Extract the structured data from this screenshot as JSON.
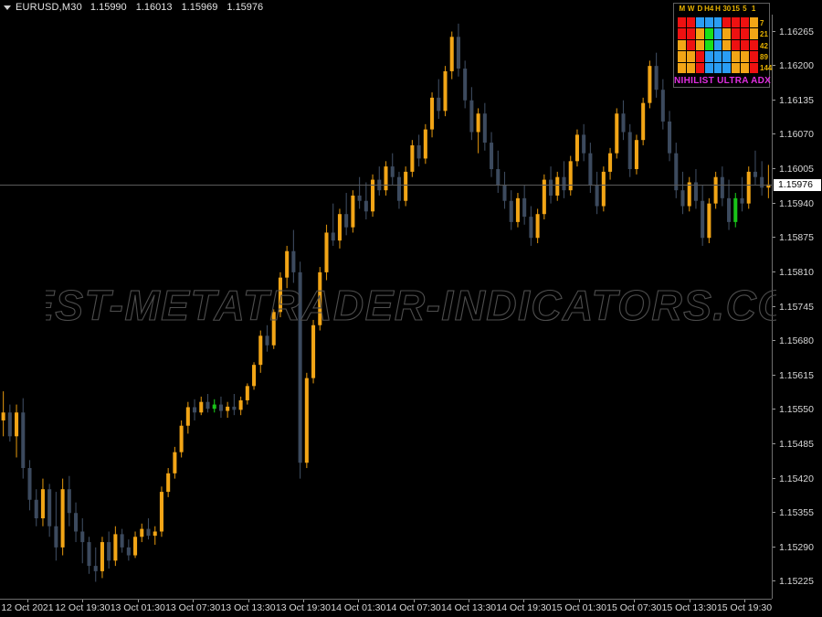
{
  "window": {
    "symbol_line": "EURUSD,M30",
    "dropdown_icon": "triangle-down-icon"
  },
  "ohlc": {
    "open": "1.15990",
    "high": "1.16013",
    "low": "1.15969",
    "close": "1.15976"
  },
  "watermark": {
    "text": "BEST-METATRADER-INDICATORS.COM"
  },
  "price_axis": {
    "current_price": "1.15976",
    "labels": [
      "1.16265",
      "1.16200",
      "1.16135",
      "1.16070",
      "1.16005",
      "1.15940",
      "1.15875",
      "1.15810",
      "1.15745",
      "1.15680",
      "1.15615",
      "1.15550",
      "1.15485",
      "1.15420",
      "1.15355",
      "1.15290",
      "1.15225"
    ]
  },
  "time_axis": {
    "labels": [
      "12 Oct 2021",
      "12 Oct 19:30",
      "13 Oct 01:30",
      "13 Oct 07:30",
      "13 Oct 13:30",
      "13 Oct 19:30",
      "14 Oct 01:30",
      "14 Oct 07:30",
      "14 Oct 13:30",
      "14 Oct 19:30",
      "15 Oct 01:30",
      "15 Oct 07:30",
      "15 Oct 13:30",
      "15 Oct 19:30"
    ]
  },
  "indicator": {
    "name": "NIHILIST ULTRA ADX",
    "columns": [
      "M",
      "W",
      "D",
      "H4",
      "H",
      "30",
      "15",
      "5",
      "1"
    ],
    "rows": [
      "7",
      "21",
      "42",
      "89",
      "144"
    ],
    "colors": {
      "red": "#ee1111",
      "blue": "#2a9df4",
      "orange": "#f2a516",
      "green": "#19e019"
    },
    "grid": [
      [
        "red",
        "red",
        "blue",
        "blue",
        "blue",
        "red",
        "red",
        "red",
        "orange"
      ],
      [
        "red",
        "red",
        "orange",
        "green",
        "blue",
        "orange",
        "red",
        "red",
        "orange"
      ],
      [
        "orange",
        "red",
        "orange",
        "green",
        "blue",
        "orange",
        "red",
        "red",
        "red"
      ],
      [
        "orange",
        "orange",
        "red",
        "blue",
        "blue",
        "blue",
        "orange",
        "orange",
        "red"
      ],
      [
        "orange",
        "orange",
        "red",
        "blue",
        "blue",
        "blue",
        "orange",
        "orange",
        "red"
      ]
    ]
  },
  "chart_data": {
    "type": "candlestick",
    "title": "EURUSD,M30",
    "xlabel": "",
    "ylabel": "",
    "ylim": [
      1.15193,
      1.16297
    ],
    "colors": {
      "bull": "#f2a516",
      "bear": "#3c4a5e",
      "doji": "#19c419",
      "wick_bull": "#d18b0c",
      "wick_bear": "#3c4a5e"
    },
    "grid": false,
    "price_line": 1.15976,
    "candles": [
      {
        "o": 1.1553,
        "h": 1.15585,
        "l": 1.155,
        "c": 1.15545,
        "d": "up"
      },
      {
        "o": 1.15545,
        "h": 1.1556,
        "l": 1.1549,
        "c": 1.155,
        "d": "down"
      },
      {
        "o": 1.155,
        "h": 1.1556,
        "l": 1.1546,
        "c": 1.15545,
        "d": "up"
      },
      {
        "o": 1.15545,
        "h": 1.15572,
        "l": 1.1542,
        "c": 1.1544,
        "d": "down"
      },
      {
        "o": 1.1544,
        "h": 1.15455,
        "l": 1.1536,
        "c": 1.1538,
        "d": "down"
      },
      {
        "o": 1.1538,
        "h": 1.154,
        "l": 1.1533,
        "c": 1.15345,
        "d": "down"
      },
      {
        "o": 1.15345,
        "h": 1.1542,
        "l": 1.1533,
        "c": 1.154,
        "d": "up"
      },
      {
        "o": 1.154,
        "h": 1.1541,
        "l": 1.1531,
        "c": 1.1533,
        "d": "down"
      },
      {
        "o": 1.1533,
        "h": 1.15395,
        "l": 1.15265,
        "c": 1.1529,
        "d": "down"
      },
      {
        "o": 1.1529,
        "h": 1.1542,
        "l": 1.15275,
        "c": 1.154,
        "d": "up"
      },
      {
        "o": 1.154,
        "h": 1.15425,
        "l": 1.1533,
        "c": 1.15355,
        "d": "down"
      },
      {
        "o": 1.15355,
        "h": 1.15375,
        "l": 1.153,
        "c": 1.1532,
        "d": "down"
      },
      {
        "o": 1.1532,
        "h": 1.15345,
        "l": 1.1526,
        "c": 1.153,
        "d": "down"
      },
      {
        "o": 1.153,
        "h": 1.1531,
        "l": 1.1524,
        "c": 1.15255,
        "d": "down"
      },
      {
        "o": 1.15255,
        "h": 1.1529,
        "l": 1.15225,
        "c": 1.15245,
        "d": "down"
      },
      {
        "o": 1.15245,
        "h": 1.1531,
        "l": 1.15232,
        "c": 1.153,
        "d": "up"
      },
      {
        "o": 1.153,
        "h": 1.1532,
        "l": 1.1525,
        "c": 1.15265,
        "d": "down"
      },
      {
        "o": 1.15265,
        "h": 1.1533,
        "l": 1.15255,
        "c": 1.15315,
        "d": "up"
      },
      {
        "o": 1.15315,
        "h": 1.15325,
        "l": 1.1528,
        "c": 1.1529,
        "d": "down"
      },
      {
        "o": 1.1529,
        "h": 1.15305,
        "l": 1.15265,
        "c": 1.15275,
        "d": "down"
      },
      {
        "o": 1.15275,
        "h": 1.1532,
        "l": 1.1527,
        "c": 1.1531,
        "d": "up"
      },
      {
        "o": 1.1531,
        "h": 1.15335,
        "l": 1.153,
        "c": 1.15325,
        "d": "up"
      },
      {
        "o": 1.15325,
        "h": 1.15345,
        "l": 1.15305,
        "c": 1.15312,
        "d": "down"
      },
      {
        "o": 1.15312,
        "h": 1.1533,
        "l": 1.15295,
        "c": 1.1532,
        "d": "up"
      },
      {
        "o": 1.1532,
        "h": 1.15405,
        "l": 1.1531,
        "c": 1.15395,
        "d": "up"
      },
      {
        "o": 1.15395,
        "h": 1.1544,
        "l": 1.15385,
        "c": 1.1543,
        "d": "up"
      },
      {
        "o": 1.1543,
        "h": 1.1548,
        "l": 1.1542,
        "c": 1.1547,
        "d": "up"
      },
      {
        "o": 1.1547,
        "h": 1.1553,
        "l": 1.1546,
        "c": 1.1552,
        "d": "up"
      },
      {
        "o": 1.1552,
        "h": 1.15565,
        "l": 1.15505,
        "c": 1.15555,
        "d": "up"
      },
      {
        "o": 1.15555,
        "h": 1.1557,
        "l": 1.1553,
        "c": 1.15545,
        "d": "down"
      },
      {
        "o": 1.15545,
        "h": 1.15575,
        "l": 1.1554,
        "c": 1.15565,
        "d": "up"
      },
      {
        "o": 1.15565,
        "h": 1.1558,
        "l": 1.15545,
        "c": 1.15552,
        "d": "down"
      },
      {
        "o": 1.15552,
        "h": 1.1557,
        "l": 1.15545,
        "c": 1.1556,
        "d": "doji"
      },
      {
        "o": 1.1556,
        "h": 1.15575,
        "l": 1.15535,
        "c": 1.15548,
        "d": "down"
      },
      {
        "o": 1.15548,
        "h": 1.15565,
        "l": 1.15535,
        "c": 1.15556,
        "d": "up"
      },
      {
        "o": 1.15556,
        "h": 1.1558,
        "l": 1.1554,
        "c": 1.1555,
        "d": "down"
      },
      {
        "o": 1.1555,
        "h": 1.15575,
        "l": 1.1554,
        "c": 1.15568,
        "d": "up"
      },
      {
        "o": 1.15568,
        "h": 1.156,
        "l": 1.1556,
        "c": 1.15595,
        "d": "up"
      },
      {
        "o": 1.15595,
        "h": 1.1564,
        "l": 1.15588,
        "c": 1.15635,
        "d": "up"
      },
      {
        "o": 1.15635,
        "h": 1.157,
        "l": 1.1562,
        "c": 1.1569,
        "d": "up"
      },
      {
        "o": 1.1569,
        "h": 1.1571,
        "l": 1.1566,
        "c": 1.15672,
        "d": "down"
      },
      {
        "o": 1.15672,
        "h": 1.1574,
        "l": 1.15665,
        "c": 1.15735,
        "d": "up"
      },
      {
        "o": 1.15735,
        "h": 1.1581,
        "l": 1.15725,
        "c": 1.158,
        "d": "up"
      },
      {
        "o": 1.158,
        "h": 1.1586,
        "l": 1.1578,
        "c": 1.1585,
        "d": "up"
      },
      {
        "o": 1.1585,
        "h": 1.1589,
        "l": 1.1579,
        "c": 1.1581,
        "d": "down"
      },
      {
        "o": 1.1581,
        "h": 1.1583,
        "l": 1.1542,
        "c": 1.1545,
        "d": "down"
      },
      {
        "o": 1.1545,
        "h": 1.1562,
        "l": 1.1544,
        "c": 1.1561,
        "d": "up"
      },
      {
        "o": 1.1561,
        "h": 1.1572,
        "l": 1.156,
        "c": 1.1571,
        "d": "up"
      },
      {
        "o": 1.1571,
        "h": 1.1582,
        "l": 1.157,
        "c": 1.1581,
        "d": "up"
      },
      {
        "o": 1.1581,
        "h": 1.159,
        "l": 1.15795,
        "c": 1.15885,
        "d": "up"
      },
      {
        "o": 1.15885,
        "h": 1.1594,
        "l": 1.1586,
        "c": 1.1587,
        "d": "down"
      },
      {
        "o": 1.1587,
        "h": 1.1593,
        "l": 1.15855,
        "c": 1.1592,
        "d": "up"
      },
      {
        "o": 1.1592,
        "h": 1.1596,
        "l": 1.1588,
        "c": 1.15895,
        "d": "down"
      },
      {
        "o": 1.15895,
        "h": 1.15965,
        "l": 1.15885,
        "c": 1.15955,
        "d": "up"
      },
      {
        "o": 1.15955,
        "h": 1.1599,
        "l": 1.1593,
        "c": 1.15945,
        "d": "down"
      },
      {
        "o": 1.15945,
        "h": 1.1598,
        "l": 1.1591,
        "c": 1.15925,
        "d": "down"
      },
      {
        "o": 1.15925,
        "h": 1.15995,
        "l": 1.15915,
        "c": 1.15985,
        "d": "up"
      },
      {
        "o": 1.15985,
        "h": 1.1601,
        "l": 1.15955,
        "c": 1.15965,
        "d": "down"
      },
      {
        "o": 1.15965,
        "h": 1.1602,
        "l": 1.15955,
        "c": 1.1601,
        "d": "up"
      },
      {
        "o": 1.1601,
        "h": 1.16035,
        "l": 1.15975,
        "c": 1.1599,
        "d": "down"
      },
      {
        "o": 1.1599,
        "h": 1.16,
        "l": 1.1593,
        "c": 1.15945,
        "d": "down"
      },
      {
        "o": 1.15945,
        "h": 1.1601,
        "l": 1.15935,
        "c": 1.16,
        "d": "up"
      },
      {
        "o": 1.16,
        "h": 1.1606,
        "l": 1.1599,
        "c": 1.1605,
        "d": "up"
      },
      {
        "o": 1.1605,
        "h": 1.1607,
        "l": 1.1601,
        "c": 1.16025,
        "d": "down"
      },
      {
        "o": 1.16025,
        "h": 1.1609,
        "l": 1.16015,
        "c": 1.1608,
        "d": "up"
      },
      {
        "o": 1.1608,
        "h": 1.1615,
        "l": 1.16065,
        "c": 1.1614,
        "d": "up"
      },
      {
        "o": 1.1614,
        "h": 1.16175,
        "l": 1.161,
        "c": 1.16115,
        "d": "down"
      },
      {
        "o": 1.16115,
        "h": 1.162,
        "l": 1.16105,
        "c": 1.1619,
        "d": "up"
      },
      {
        "o": 1.1619,
        "h": 1.16265,
        "l": 1.16175,
        "c": 1.16255,
        "d": "up"
      },
      {
        "o": 1.16255,
        "h": 1.1628,
        "l": 1.1618,
        "c": 1.16195,
        "d": "down"
      },
      {
        "o": 1.16195,
        "h": 1.1621,
        "l": 1.1612,
        "c": 1.16135,
        "d": "down"
      },
      {
        "o": 1.16135,
        "h": 1.1616,
        "l": 1.1606,
        "c": 1.16075,
        "d": "down"
      },
      {
        "o": 1.16075,
        "h": 1.1612,
        "l": 1.16035,
        "c": 1.1611,
        "d": "up"
      },
      {
        "o": 1.1611,
        "h": 1.1613,
        "l": 1.1604,
        "c": 1.16055,
        "d": "down"
      },
      {
        "o": 1.16055,
        "h": 1.16075,
        "l": 1.1599,
        "c": 1.16005,
        "d": "down"
      },
      {
        "o": 1.16005,
        "h": 1.1604,
        "l": 1.1596,
        "c": 1.15975,
        "d": "down"
      },
      {
        "o": 1.15975,
        "h": 1.16,
        "l": 1.1593,
        "c": 1.15945,
        "d": "down"
      },
      {
        "o": 1.15945,
        "h": 1.15965,
        "l": 1.1589,
        "c": 1.15905,
        "d": "down"
      },
      {
        "o": 1.15905,
        "h": 1.1596,
        "l": 1.15895,
        "c": 1.1595,
        "d": "up"
      },
      {
        "o": 1.1595,
        "h": 1.15975,
        "l": 1.159,
        "c": 1.15915,
        "d": "down"
      },
      {
        "o": 1.15915,
        "h": 1.15935,
        "l": 1.1586,
        "c": 1.15875,
        "d": "down"
      },
      {
        "o": 1.15875,
        "h": 1.1593,
        "l": 1.15865,
        "c": 1.1592,
        "d": "up"
      },
      {
        "o": 1.1592,
        "h": 1.15995,
        "l": 1.1591,
        "c": 1.15985,
        "d": "up"
      },
      {
        "o": 1.15985,
        "h": 1.1601,
        "l": 1.1594,
        "c": 1.15955,
        "d": "down"
      },
      {
        "o": 1.15955,
        "h": 1.16,
        "l": 1.15945,
        "c": 1.1599,
        "d": "up"
      },
      {
        "o": 1.1599,
        "h": 1.1602,
        "l": 1.1595,
        "c": 1.15965,
        "d": "down"
      },
      {
        "o": 1.15965,
        "h": 1.1603,
        "l": 1.15955,
        "c": 1.1602,
        "d": "up"
      },
      {
        "o": 1.1602,
        "h": 1.1608,
        "l": 1.1601,
        "c": 1.1607,
        "d": "up"
      },
      {
        "o": 1.1607,
        "h": 1.1609,
        "l": 1.1602,
        "c": 1.16035,
        "d": "down"
      },
      {
        "o": 1.16035,
        "h": 1.16055,
        "l": 1.1596,
        "c": 1.15975,
        "d": "down"
      },
      {
        "o": 1.15975,
        "h": 1.16,
        "l": 1.1592,
        "c": 1.15935,
        "d": "down"
      },
      {
        "o": 1.15935,
        "h": 1.1601,
        "l": 1.15925,
        "c": 1.16,
        "d": "up"
      },
      {
        "o": 1.16,
        "h": 1.16045,
        "l": 1.15985,
        "c": 1.16035,
        "d": "up"
      },
      {
        "o": 1.16035,
        "h": 1.1612,
        "l": 1.16025,
        "c": 1.1611,
        "d": "up"
      },
      {
        "o": 1.1611,
        "h": 1.16135,
        "l": 1.1606,
        "c": 1.16075,
        "d": "down"
      },
      {
        "o": 1.16075,
        "h": 1.1609,
        "l": 1.1599,
        "c": 1.16005,
        "d": "down"
      },
      {
        "o": 1.16005,
        "h": 1.1607,
        "l": 1.15995,
        "c": 1.1606,
        "d": "up"
      },
      {
        "o": 1.1606,
        "h": 1.1614,
        "l": 1.1605,
        "c": 1.1613,
        "d": "up"
      },
      {
        "o": 1.1613,
        "h": 1.1621,
        "l": 1.1612,
        "c": 1.162,
        "d": "up"
      },
      {
        "o": 1.162,
        "h": 1.16225,
        "l": 1.1614,
        "c": 1.16155,
        "d": "down"
      },
      {
        "o": 1.16155,
        "h": 1.16175,
        "l": 1.1608,
        "c": 1.16095,
        "d": "down"
      },
      {
        "o": 1.16095,
        "h": 1.16115,
        "l": 1.1602,
        "c": 1.16035,
        "d": "down"
      },
      {
        "o": 1.16035,
        "h": 1.16055,
        "l": 1.1595,
        "c": 1.15965,
        "d": "down"
      },
      {
        "o": 1.15965,
        "h": 1.16,
        "l": 1.1592,
        "c": 1.15935,
        "d": "down"
      },
      {
        "o": 1.15935,
        "h": 1.1599,
        "l": 1.15925,
        "c": 1.1598,
        "d": "up"
      },
      {
        "o": 1.1598,
        "h": 1.16005,
        "l": 1.1593,
        "c": 1.15945,
        "d": "down"
      },
      {
        "o": 1.15945,
        "h": 1.15975,
        "l": 1.1586,
        "c": 1.15875,
        "d": "down"
      },
      {
        "o": 1.15875,
        "h": 1.1595,
        "l": 1.15865,
        "c": 1.1594,
        "d": "up"
      },
      {
        "o": 1.1594,
        "h": 1.16,
        "l": 1.1593,
        "c": 1.1599,
        "d": "up"
      },
      {
        "o": 1.1599,
        "h": 1.1601,
        "l": 1.15935,
        "c": 1.1595,
        "d": "down"
      },
      {
        "o": 1.1595,
        "h": 1.15985,
        "l": 1.1589,
        "c": 1.15905,
        "d": "down"
      },
      {
        "o": 1.15905,
        "h": 1.1596,
        "l": 1.15895,
        "c": 1.1595,
        "d": "doji"
      },
      {
        "o": 1.1595,
        "h": 1.1599,
        "l": 1.15925,
        "c": 1.1594,
        "d": "down"
      },
      {
        "o": 1.1594,
        "h": 1.1601,
        "l": 1.1593,
        "c": 1.16,
        "d": "up"
      },
      {
        "o": 1.16,
        "h": 1.1604,
        "l": 1.15975,
        "c": 1.1599,
        "d": "down"
      },
      {
        "o": 1.1599,
        "h": 1.1602,
        "l": 1.15955,
        "c": 1.1597,
        "d": "down"
      },
      {
        "o": 1.1597,
        "h": 1.16013,
        "l": 1.1595,
        "c": 1.15976,
        "d": "up"
      }
    ]
  }
}
